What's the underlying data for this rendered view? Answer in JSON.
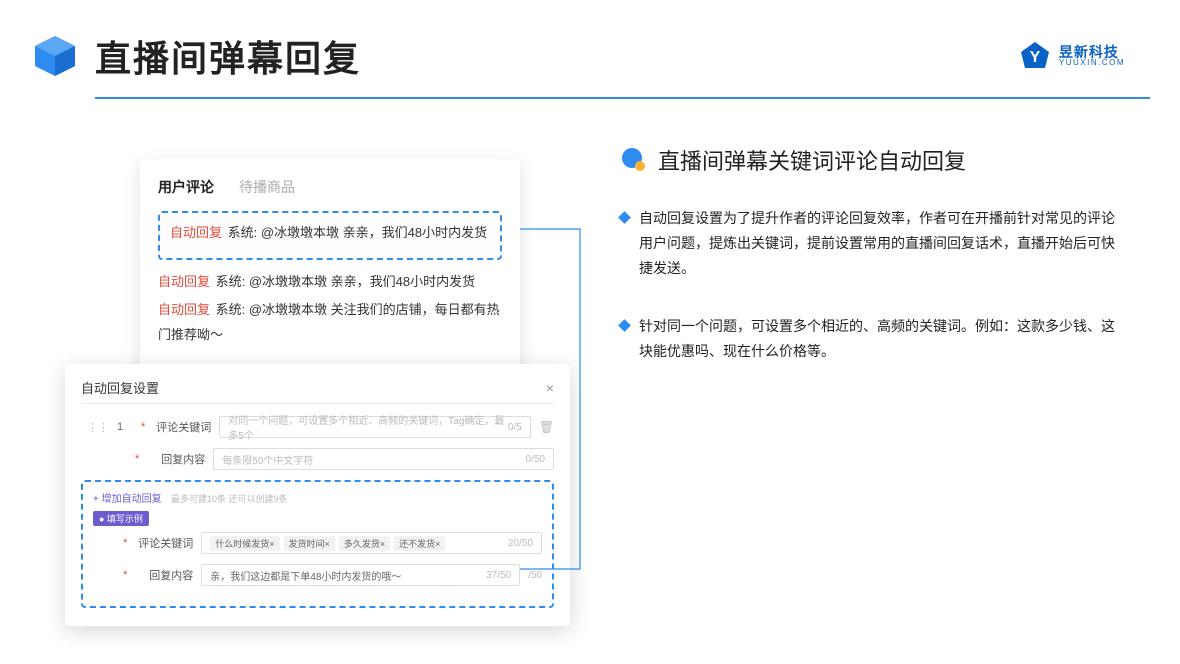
{
  "header": {
    "title": "直播间弹幕回复"
  },
  "brand": {
    "cn": "昱新科技",
    "url": "YUUXIN.COM"
  },
  "comments": {
    "tab_active": "用户评论",
    "tab_inactive": "待播商品",
    "items": [
      {
        "badge": "自动回复",
        "text": "系统: @冰墩墩本墩 亲亲，我们48小时内发货"
      },
      {
        "badge": "自动回复",
        "text": "系统: @冰墩墩本墩 亲亲，我们48小时内发货"
      },
      {
        "badge": "自动回复",
        "text": "系统: @冰墩墩本墩 关注我们的店铺，每日都有热门推荐呦～"
      }
    ]
  },
  "settings": {
    "title": "自动回复设置",
    "row_num": "1",
    "kw_label": "评论关键词",
    "kw_placeholder": "对同一个问题，可设置多个相近、高频的关键词，Tag确定，最多5个",
    "kw_count": "0/5",
    "reply_label": "回复内容",
    "reply_placeholder": "每条限50个中文字符",
    "reply_count": "0/50",
    "add_link": "+ 增加自动回复",
    "add_hint": "最多可建10条 还可以创建9条",
    "example_tag": "● 填写示例",
    "ex_kw_label": "评论关键词",
    "ex_tags": [
      "什么时候发货×",
      "发货时间×",
      "多久发货×",
      "还不发货×"
    ],
    "ex_kw_count": "20/50",
    "ex_reply_label": "回复内容",
    "ex_reply_text": "亲，我们这边都是下单48小时内发货的哦～",
    "ex_reply_count": "37/50",
    "outer_count": "/50"
  },
  "right": {
    "title": "直播间弹幕关键词评论自动回复",
    "bullets": [
      "自动回复设置为了提升作者的评论回复效率，作者可在开播前针对常见的评论用户问题，提炼出关键词，提前设置常用的直播间回复话术，直播开始后可快捷发送。",
      "针对同一个问题，可设置多个相近的、高频的关键词。例如：这款多少钱、这块能优惠吗、现在什么价格等。"
    ]
  }
}
